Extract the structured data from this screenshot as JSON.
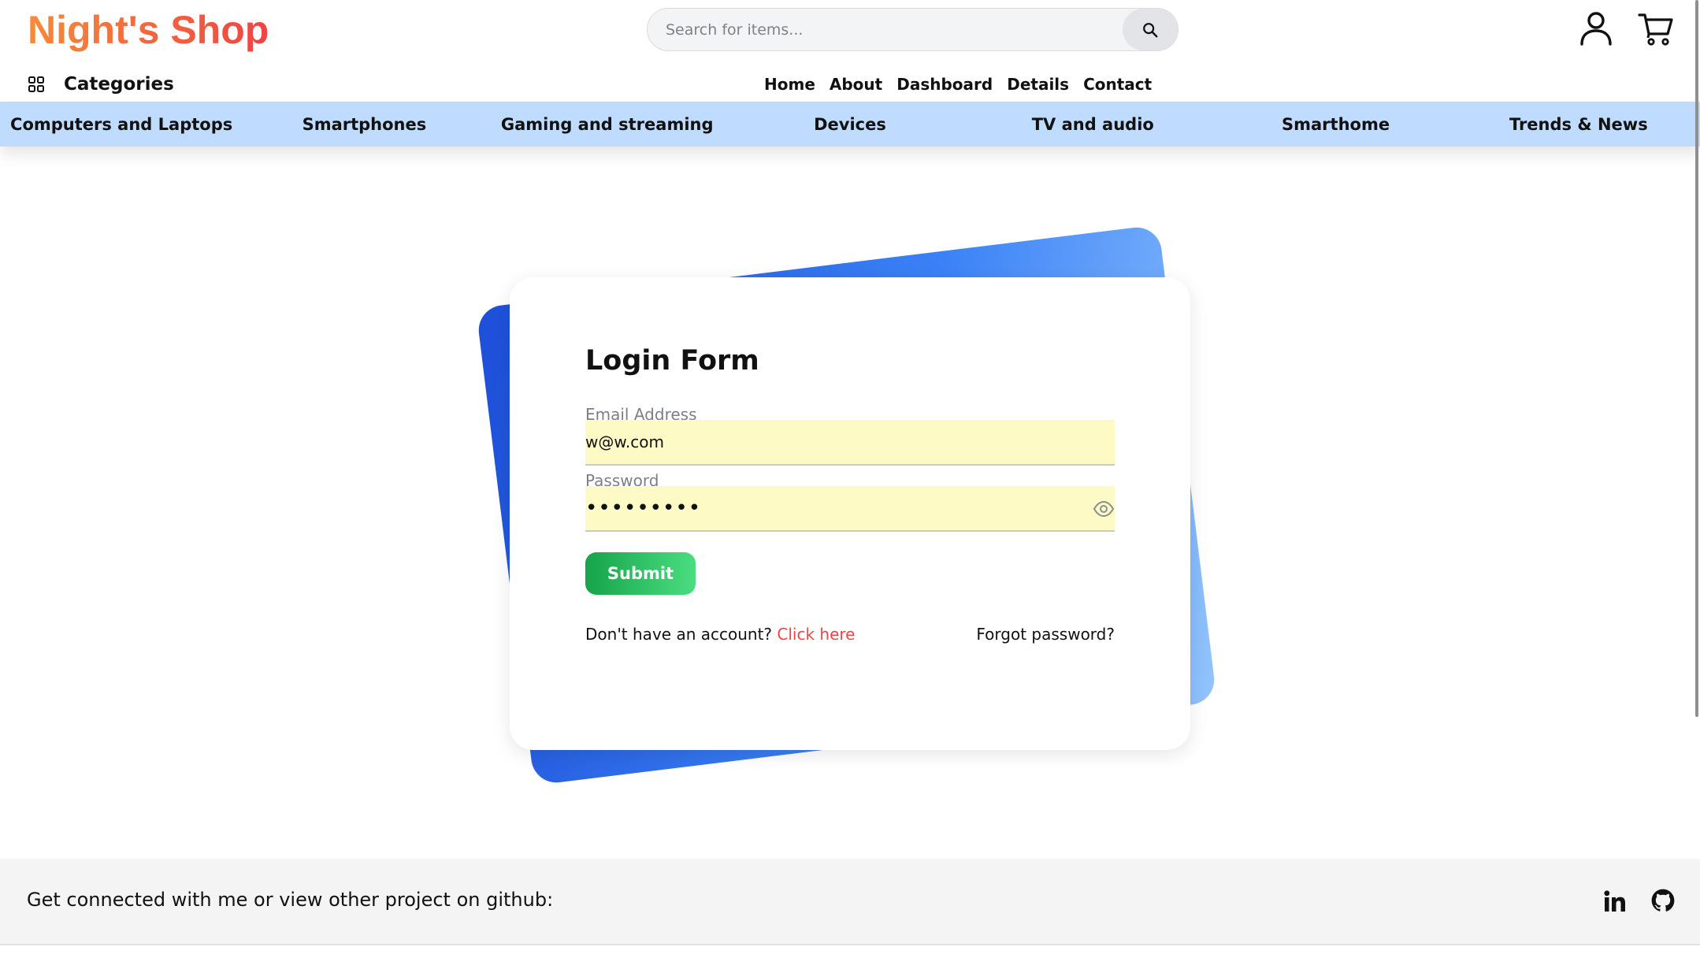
{
  "header": {
    "logo": "Night's Shop",
    "search_placeholder": "Search for items...",
    "categories_label": "Categories",
    "nav": [
      "Home",
      "About",
      "Dashboard",
      "Details",
      "Contact"
    ]
  },
  "category_bar": [
    "Computers and Laptops",
    "Smartphones",
    "Gaming and streaming",
    "Devices",
    "TV and audio",
    "Smarthome",
    "Trends & News"
  ],
  "login": {
    "title": "Login Form",
    "email_label": "Email Address",
    "email_value": "w@w.com",
    "password_label": "Password",
    "password_value": "123456789",
    "submit_label": "Submit",
    "no_account_text": "Don't have an account?",
    "click_here": "Click here",
    "forgot_password": "Forgot password?"
  },
  "footer": {
    "text": "Get connected with me or view other project on github:"
  },
  "icons": {
    "search": "search-icon",
    "user": "user-icon",
    "cart": "cart-icon",
    "grid": "grid-icon",
    "eye": "eye-icon",
    "linkedin": "linkedin-icon",
    "github": "github-icon"
  },
  "colors": {
    "logo_gradient_start": "#f58b3a",
    "logo_gradient_end": "#ef4444",
    "category_bar": "#bfdbfe",
    "card_back_start": "#1d4ed8",
    "card_back_end": "#93c5fd",
    "input_background": "#fefac6",
    "submit_start": "#16a34a",
    "submit_end": "#4ade80",
    "link_red": "#ef4444"
  }
}
